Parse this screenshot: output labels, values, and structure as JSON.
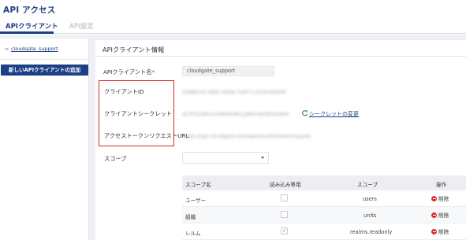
{
  "page": {
    "title": "API アクセス"
  },
  "tabs": [
    {
      "label": "APIクライアント",
      "active": true
    },
    {
      "label": "API設定",
      "active": false
    }
  ],
  "sidebar": {
    "item_label": "cloudgate_support",
    "item_icon": "chevron-code-icon",
    "add_button_label": "新しいAPIクライアントの追加"
  },
  "panel": {
    "title": "APIクライアント情報",
    "name_label": "APIクライアント名",
    "required_mark": "*",
    "name_value": "cloudgate_support",
    "client_id_label": "クライアントID",
    "client_id_value": "a3d8e1f2-4b6c-9a0d-7e5f-1c2b3a4d5e6f",
    "client_secret_label": "クライアントシークレット",
    "client_secret_value": "xk7P2nQ9vLm4Rt8sWz1yB6cHd3JfG5aKe0",
    "secret_change_label": "シークレットの変更",
    "token_url_label": "アクセストークンリクエストURL",
    "token_url_value": "https://api.cloudgate.example/oauth/token/request",
    "scope_label": "スコープ",
    "scope_value": ""
  },
  "scope_table": {
    "headers": [
      "スコープ名",
      "読み込み専用",
      "スコープ",
      "操作"
    ],
    "rows": [
      {
        "name": "ユーザー",
        "readonly": false,
        "scope": "users",
        "action": "削除"
      },
      {
        "name": "組織",
        "readonly": false,
        "scope": "units",
        "action": "削除"
      },
      {
        "name": "レルム",
        "readonly": true,
        "scope": "realms.readonly",
        "action": "削除"
      }
    ]
  },
  "colors": {
    "brand": "#1f3f80",
    "highlight_box": "#d6262b",
    "delete": "#e0302f",
    "refresh": "#3aa14a"
  }
}
